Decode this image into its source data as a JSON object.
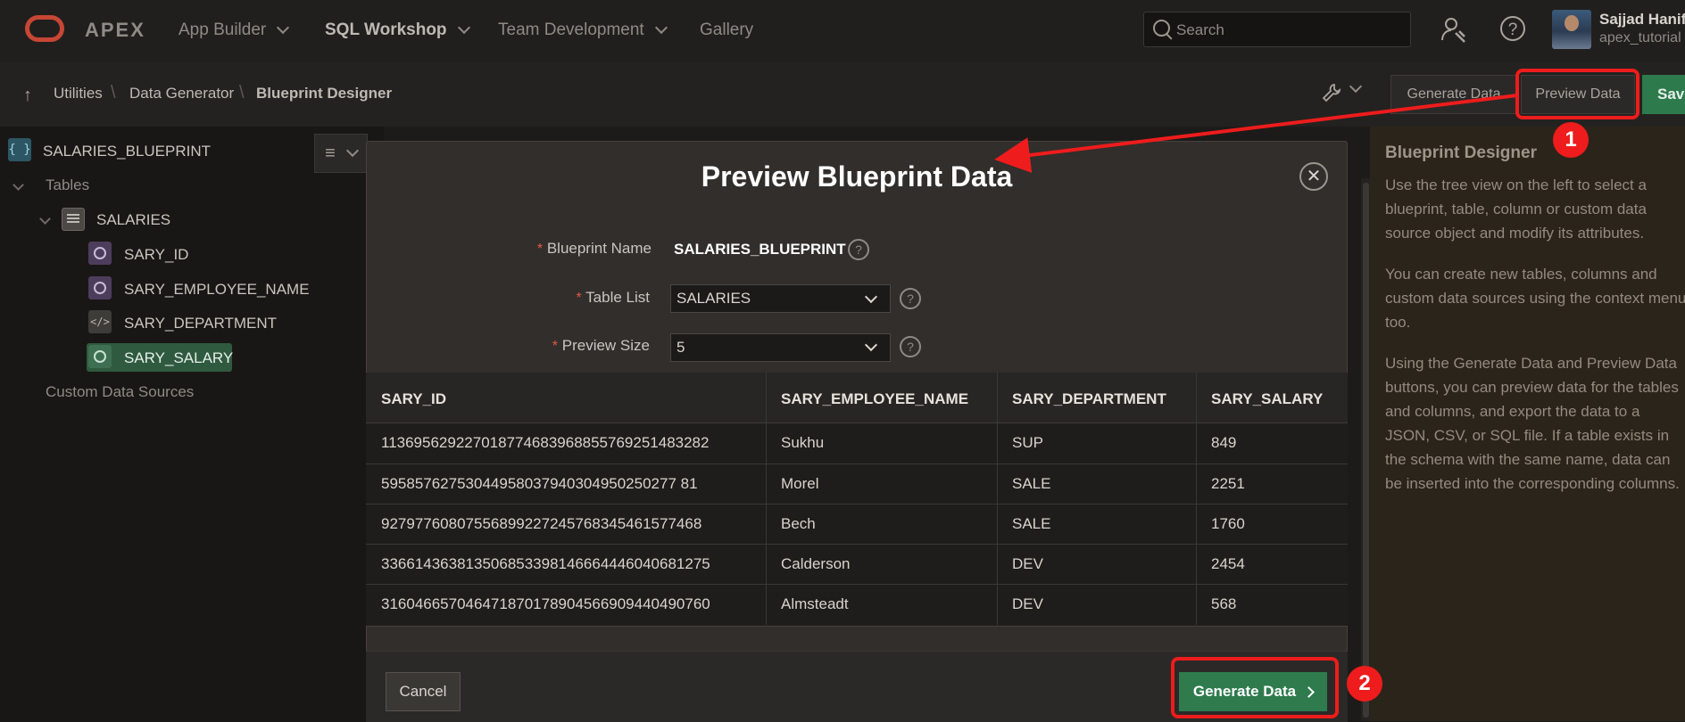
{
  "topbar": {
    "brand": "APEX",
    "nav": [
      {
        "label": "App Builder",
        "has_menu": true,
        "active": false
      },
      {
        "label": "SQL Workshop",
        "has_menu": true,
        "active": true
      },
      {
        "label": "Team Development",
        "has_menu": true,
        "active": false
      },
      {
        "label": "Gallery",
        "has_menu": false,
        "active": false
      }
    ],
    "search_placeholder": "Search",
    "user": {
      "name": "Sajjad Hanif",
      "workspace": "apex_tutorial"
    }
  },
  "breadcrumb": {
    "items": [
      "Utilities",
      "Data Generator",
      "Blueprint Designer"
    ]
  },
  "toolbar": {
    "generate_label": "Generate Data",
    "preview_label": "Preview Data",
    "save_label": "Save"
  },
  "tree": {
    "blueprint": "SALARIES_BLUEPRINT",
    "tables_label": "Tables",
    "table": "SALARIES",
    "columns": [
      "SARY_ID",
      "SARY_EMPLOYEE_NAME",
      "SARY_DEPARTMENT",
      "SARY_SALARY"
    ],
    "selected_column": "SARY_SALARY",
    "custom_sources_label": "Custom Data Sources"
  },
  "help_panel": {
    "title": "Blueprint Designer",
    "paragraphs": [
      "Use the tree view on the left to select a blueprint, table, column or custom data source object and modify its attributes.",
      "You can create new tables, columns and custom data sources using the context menu too.",
      "Using the Generate Data and Preview Data buttons, you can preview data for the tables and columns, and export the data to a JSON, CSV, or SQL file. If a table exists in the schema with the same name, data can be inserted into the corresponding columns."
    ]
  },
  "modal": {
    "title": "Preview Blueprint Data",
    "fields": {
      "blueprint_name_label": "Blueprint Name",
      "blueprint_name_value": "SALARIES_BLUEPRINT",
      "table_list_label": "Table List",
      "table_list_value": "SALARIES",
      "preview_size_label": "Preview Size",
      "preview_size_value": "5"
    },
    "grid": {
      "columns": [
        "SARY_ID",
        "SARY_EMPLOYEE_NAME",
        "SARY_DEPARTMENT",
        "SARY_SALARY"
      ],
      "rows": [
        [
          "113695629227018774683968855769251483282",
          "Sukhu",
          "SUP",
          "849"
        ],
        [
          "59585762753044958037940304950250277 81",
          "Morel",
          "SALE",
          "2251"
        ],
        [
          "92797760807556899227245768345461577468",
          "Bech",
          "SALE",
          "1760"
        ],
        [
          "336614363813506853398146664446040681275",
          "Calderson",
          "DEV",
          "2454"
        ],
        [
          "316046657046471870178904566909440490760",
          "Almsteadt",
          "DEV",
          "568"
        ]
      ]
    },
    "cancel_label": "Cancel",
    "generate_label": "Generate Data"
  },
  "annotations": {
    "step1": "1",
    "step2": "2"
  },
  "colors": {
    "annotation_red": "#ee1c1c",
    "primary_green": "#2f7b4e",
    "oracle_red": "#c74634"
  }
}
